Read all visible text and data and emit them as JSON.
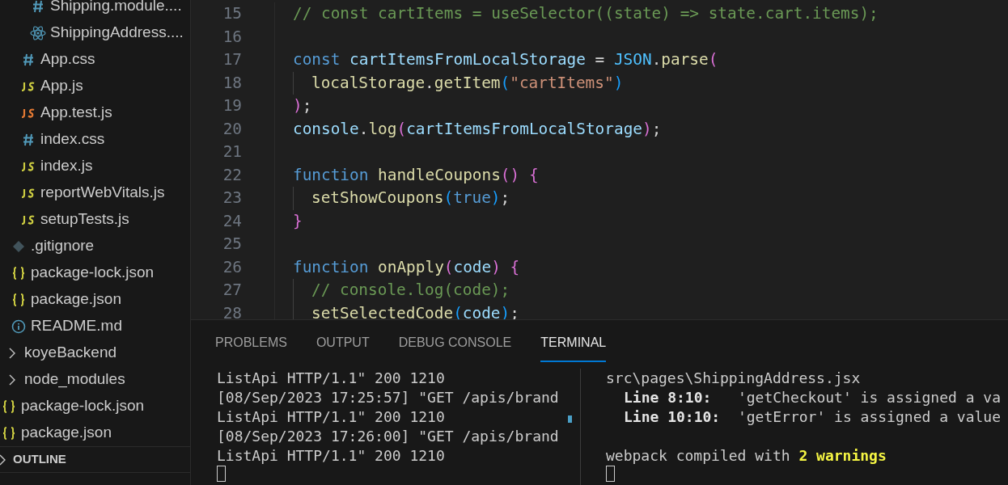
{
  "explorer": {
    "items": [
      {
        "children": [
          {
            "children": [
              {
                "children": [
                  {
                    "label": "Shipping.module....",
                    "kind": "css"
                  },
                  {
                    "label": "ShippingAddress....",
                    "kind": "react"
                  }
                ]
              },
              {
                "label": "App.css",
                "kind": "css"
              },
              {
                "label": "App.js",
                "kind": "js"
              },
              {
                "label": "App.test.js",
                "kind": "test"
              },
              {
                "label": "index.css",
                "kind": "css"
              },
              {
                "label": "index.js",
                "kind": "js"
              },
              {
                "label": "reportWebVitals.js",
                "kind": "js"
              },
              {
                "label": "setupTests.js",
                "kind": "js"
              }
            ]
          },
          {
            "label": ".gitignore",
            "kind": "git"
          },
          {
            "label": "package-lock.json",
            "kind": "json"
          },
          {
            "label": "package.json",
            "kind": "json"
          },
          {
            "label": "README.md",
            "kind": "info"
          }
        ]
      },
      {
        "label": "koyeBackend",
        "kind": "folder",
        "expanded": false
      },
      {
        "label": "node_modules",
        "kind": "folder",
        "expanded": false
      },
      {
        "label": "package-lock.json",
        "kind": "json"
      },
      {
        "label": "package.json",
        "kind": "json"
      }
    ],
    "sections": [
      {
        "label": "OUTLINE",
        "expanded": false
      }
    ]
  },
  "editor": {
    "lines": [
      {
        "number": "15",
        "guide": false,
        "tokens": [
          {
            "text": "// const cartItems = useSelector((state) => state.cart.items);",
            "kind": "comment"
          }
        ]
      },
      {
        "number": "16",
        "guide": false
      },
      {
        "number": "17",
        "guide": false,
        "tokens": [
          {
            "text": "const",
            "kind": "keyword"
          },
          {
            "text": " cartItemsFromLocalStorage",
            "kind": "variable"
          },
          {
            "text": " =",
            "kind": "punct"
          },
          {
            "text": " JSON",
            "kind": "constant"
          },
          {
            "text": ".",
            "kind": "punct"
          },
          {
            "text": "parse",
            "kind": "function"
          },
          {
            "text": "(",
            "kind": "pink"
          }
        ]
      },
      {
        "number": "18",
        "guide": true,
        "tokens": [
          {
            "text": "localStorage",
            "kind": "function"
          },
          {
            "text": ".",
            "kind": "punct"
          },
          {
            "text": "getItem",
            "kind": "function"
          },
          {
            "text": "(",
            "kind": "blue"
          },
          {
            "text": "\"cartItems\"",
            "kind": "string"
          },
          {
            "text": ")",
            "kind": "blue"
          }
        ]
      },
      {
        "number": "19",
        "guide": false,
        "tokens": [
          {
            "text": ")",
            "kind": "pink"
          },
          {
            "text": ";",
            "kind": "punct"
          }
        ]
      },
      {
        "number": "20",
        "guide": false,
        "tokens": [
          {
            "text": "console",
            "kind": "variable"
          },
          {
            "text": ".",
            "kind": "punct"
          },
          {
            "text": "log",
            "kind": "function"
          },
          {
            "text": "(",
            "kind": "pink"
          },
          {
            "text": "cartItemsFromLocalStorage",
            "kind": "variable"
          },
          {
            "text": ")",
            "kind": "pink"
          },
          {
            "text": ";",
            "kind": "punct"
          }
        ]
      },
      {
        "number": "21",
        "guide": false
      },
      {
        "number": "22",
        "guide": false,
        "tokens": [
          {
            "text": "function",
            "kind": "keyword"
          },
          {
            "text": " handleCoupons",
            "kind": "function"
          },
          {
            "text": "()",
            "kind": "pink"
          },
          {
            "text": " {",
            "kind": "pink"
          }
        ]
      },
      {
        "number": "23",
        "guide": true,
        "tokens": [
          {
            "text": "setShowCoupons",
            "kind": "function"
          },
          {
            "text": "(",
            "kind": "blue"
          },
          {
            "text": "true",
            "kind": "keyword"
          },
          {
            "text": ")",
            "kind": "blue"
          },
          {
            "text": ";",
            "kind": "punct"
          }
        ]
      },
      {
        "number": "24",
        "guide": false,
        "tokens": [
          {
            "text": "}",
            "kind": "pink"
          }
        ]
      },
      {
        "number": "25",
        "guide": false
      },
      {
        "number": "26",
        "guide": false,
        "tokens": [
          {
            "text": "function",
            "kind": "keyword"
          },
          {
            "text": " onApply",
            "kind": "function"
          },
          {
            "text": "(",
            "kind": "pink"
          },
          {
            "text": "code",
            "kind": "variable"
          },
          {
            "text": ")",
            "kind": "pink"
          },
          {
            "text": " {",
            "kind": "pink"
          }
        ]
      },
      {
        "number": "27",
        "guide": true,
        "tokens": [
          {
            "text": "// console.log(code);",
            "kind": "comment"
          }
        ]
      },
      {
        "number": "28",
        "guide": true,
        "tokens": [
          {
            "text": "setSelectedCode",
            "kind": "function"
          },
          {
            "text": "(",
            "kind": "blue"
          },
          {
            "text": "code",
            "kind": "variable"
          },
          {
            "text": ")",
            "kind": "blue"
          },
          {
            "text": ";",
            "kind": "punct"
          }
        ]
      }
    ]
  },
  "panel": {
    "tabs": [
      {
        "label": "PROBLEMS",
        "selected": false
      },
      {
        "label": "OUTPUT",
        "selected": false
      },
      {
        "label": "DEBUG CONSOLE",
        "selected": false
      },
      {
        "label": "TERMINAL",
        "selected": true
      }
    ],
    "terminals": [
      {
        "blocks": [
          {
            "lines": [
              {
                "indented": false,
                "segments": [
                  {
                    "text": "ListApi HTTP/1.1\" 200 1210",
                    "kind": "plain"
                  }
                ]
              },
              {
                "indented": false,
                "segments": [
                  {
                    "text": "[08/Sep/2023 17:25:57] \"GET /apis/brand",
                    "kind": "plain"
                  }
                ]
              },
              {
                "indented": false,
                "segments": [
                  {
                    "text": "ListApi HTTP/1.1\" 200 1210",
                    "kind": "plain"
                  }
                ]
              },
              {
                "indented": false,
                "segments": [
                  {
                    "text": "[08/Sep/2023 17:26:00] \"GET /apis/brand",
                    "kind": "plain"
                  }
                ]
              },
              {
                "indented": false,
                "segments": [
                  {
                    "text": "ListApi HTTP/1.1\" 200 1210",
                    "kind": "plain"
                  }
                ]
              }
            ]
          }
        ]
      },
      {
        "blocks": [
          {
            "lines": [
              {
                "indented": false,
                "segments": [
                  {
                    "text": "src\\pages\\ShippingAddress.jsx",
                    "kind": "plain"
                  }
                ]
              },
              {
                "indented": true,
                "segments": [
                  {
                    "text": "Line 8:10:",
                    "kind": "bold"
                  },
                  {
                    "text": "   'getCheckout' is assigned a va",
                    "kind": "plain"
                  }
                ]
              },
              {
                "indented": true,
                "segments": [
                  {
                    "text": "Line 10:10:",
                    "kind": "bold"
                  },
                  {
                    "text": "  'getError' is assigned a value",
                    "kind": "plain"
                  }
                ]
              }
            ]
          },
          {
            "lines": [
              {
                "indented": false,
                "segments": [
                  {
                    "text": "webpack compiled with ",
                    "kind": "plain"
                  },
                  {
                    "text": "2 warnings",
                    "kind": "warning"
                  }
                ]
              }
            ]
          }
        ]
      }
    ]
  }
}
